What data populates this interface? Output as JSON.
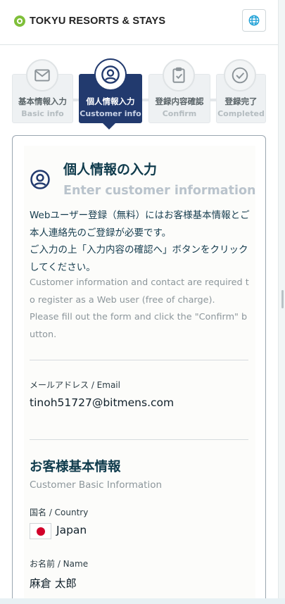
{
  "header": {
    "logo_text": "TOKYU RESORTS & STAYS",
    "language_icon": "globe-icon"
  },
  "steps": [
    {
      "ja": "基本情報入力",
      "en": "Basic info",
      "icon": "mail-icon",
      "state": "done"
    },
    {
      "ja": "個人情報入力",
      "en": "Customer info",
      "icon": "user-circle-icon",
      "state": "active"
    },
    {
      "ja": "登録内容確認",
      "en": "Confirm",
      "icon": "clipboard-check-icon",
      "state": "pending"
    },
    {
      "ja": "登録完了",
      "en": "Completed",
      "icon": "check-circle-icon",
      "state": "pending"
    }
  ],
  "section": {
    "title": "個人情報の入力",
    "subtitle": "Enter customer information",
    "desc_ja_1": "Webユーザー登録（無料）にはお客様基本情報とご本人連絡先のご登録が必要です。",
    "desc_ja_2": "ご入力の上「入力内容の確認へ」ボタンをクリックしてください。",
    "desc_en_1": "Customer information and contact are required to register as a Web user (free of charge).",
    "desc_en_2": "Please fill out the form and click the \"Confirm\" button."
  },
  "email": {
    "label": "メールアドレス / Email",
    "value": "tinoh51727@bitmens.com"
  },
  "basic_info": {
    "title": "お客様基本情報",
    "subtitle": "Customer Basic Information",
    "country_label": "国名 / Country",
    "country_value": "Japan",
    "name_label": "お名前 / Name",
    "name_value": "麻倉 太郎"
  },
  "colors": {
    "accent": "#223a6e",
    "text": "#0f3b4c",
    "muted": "#8c969b"
  }
}
